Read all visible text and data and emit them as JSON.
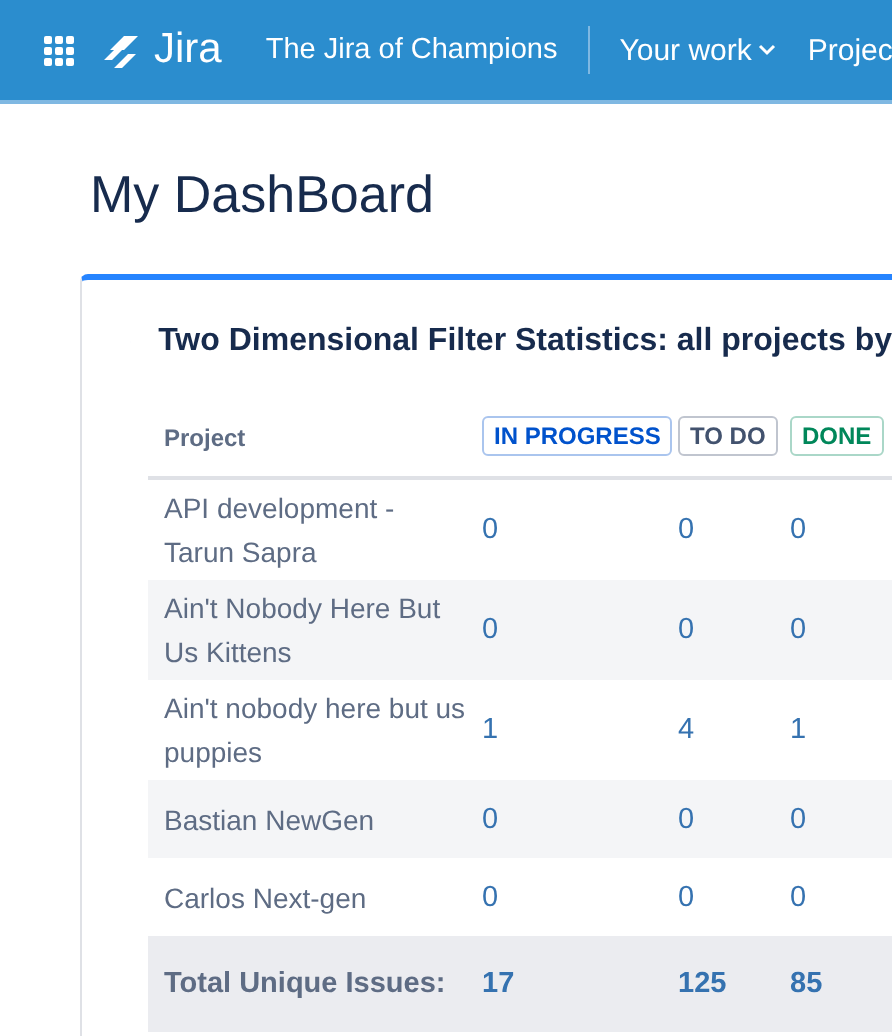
{
  "topbar": {
    "product": "Jira",
    "site": "The Jira of Champions",
    "nav": [
      {
        "label": "Your work",
        "dropdown": true
      },
      {
        "label": "Projec",
        "dropdown": false
      }
    ]
  },
  "page": {
    "title": "My DashBoard"
  },
  "gadget": {
    "title": "Two Dimensional Filter Statistics: all projects by",
    "table": {
      "header": "Project",
      "columns": [
        {
          "label": "IN PROGRESS",
          "color": "#0052cc"
        },
        {
          "label": "TO DO",
          "color": "#42526e"
        },
        {
          "label": "DONE",
          "color": "#00875a"
        }
      ],
      "rows": [
        {
          "project": "API development - Tarun Sapra",
          "values": [
            "0",
            "0",
            "0"
          ]
        },
        {
          "project": "Ain't Nobody Here But Us Kittens",
          "values": [
            "0",
            "0",
            "0"
          ]
        },
        {
          "project": "Ain't nobody here but us puppies",
          "values": [
            "1",
            "4",
            "1"
          ]
        },
        {
          "project": "Bastian NewGen",
          "values": [
            "0",
            "0",
            "0"
          ]
        },
        {
          "project": "Carlos Next-gen",
          "values": [
            "0",
            "0",
            "0"
          ]
        }
      ],
      "total": {
        "label": "Total Unique Issues:",
        "values": [
          "17",
          "125",
          "85"
        ]
      }
    }
  }
}
